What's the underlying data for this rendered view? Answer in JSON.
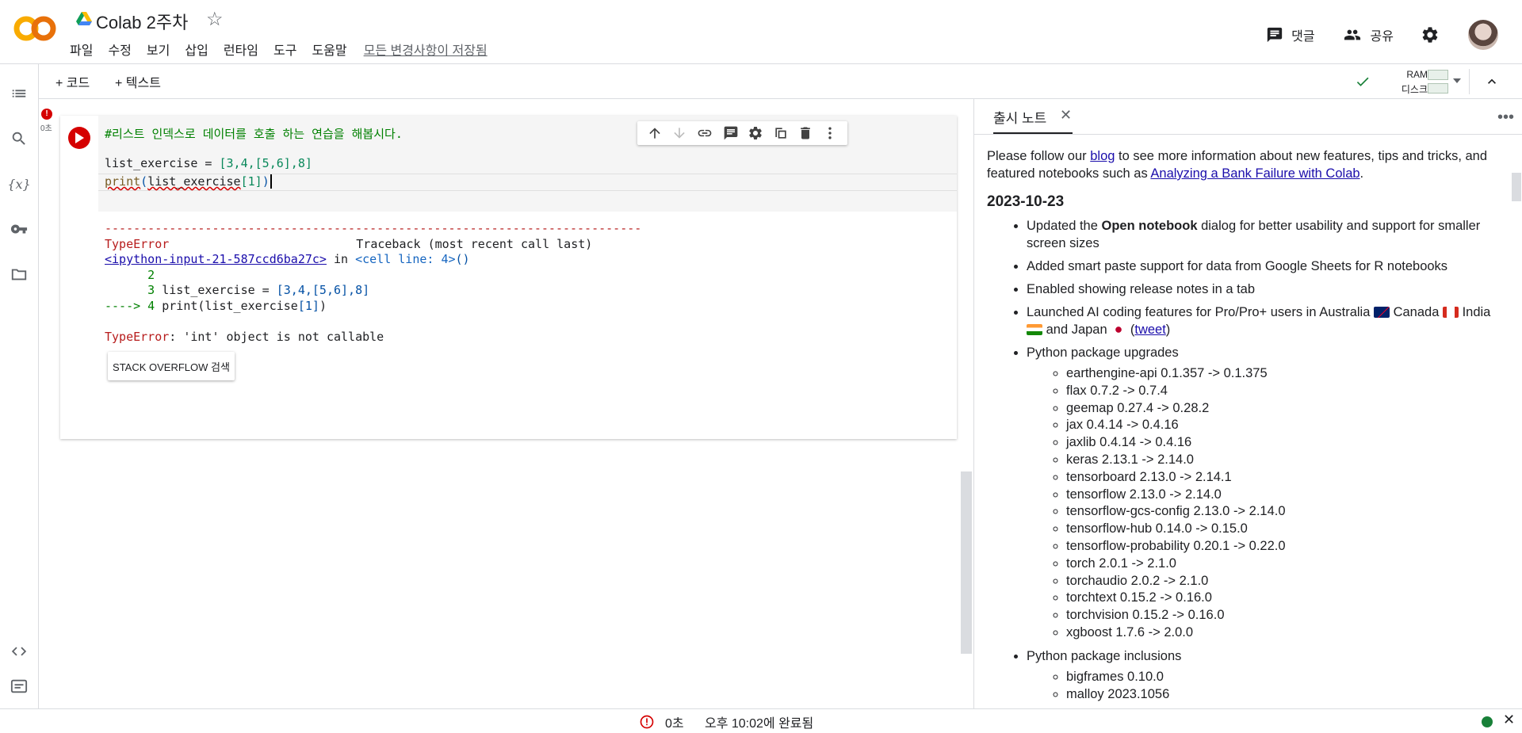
{
  "header": {
    "title": "Colab 2주차",
    "menu": [
      "파일",
      "수정",
      "보기",
      "삽입",
      "런타임",
      "도구",
      "도움말"
    ],
    "saved_status": "모든 변경사항이 저장됨",
    "comment_label": "댓글",
    "share_label": "공유"
  },
  "toolbar": {
    "add_code": "+ 코드",
    "add_text": "+ 텍스트",
    "ram_label": "RAM",
    "disk_label": "디스크"
  },
  "cell": {
    "exec_time": "0초",
    "error_badge": "!",
    "code": {
      "comment": "#리스트 인덱스로 데이터를 호출 하는 연습을 해봅시다.",
      "line2_var": "list_exercise = ",
      "line2_val": "[3,4,[5,6],8]",
      "line3_fn": "print",
      "line3_open": "(",
      "line3_arg": "list_exercise",
      "line3_idx": "[1]",
      "line3_close": ")"
    },
    "output": {
      "dashes": "---------------------------------------------------------------------------",
      "err_type": "TypeError",
      "traceback": "Traceback (most recent call last)",
      "input_link": "<ipython-input-21-587ccd6ba27c>",
      "in_word": " in ",
      "cell_line": "<cell line: 4>",
      "cell_line_parens": "()",
      "tb_l2_num": "      2",
      "tb_l3_num": "      3 ",
      "tb_l3_code": "list_exercise = ",
      "tb_l3_val": "[3,4,[5,6],8]",
      "tb_l4_arrow": "----> 4 ",
      "tb_l4_code": "print(list_exercise",
      "tb_l4_idx": "[1]",
      "tb_l4_close": ")",
      "final_type": "TypeError",
      "final_msg": ": 'int' object is not callable",
      "so_button": "STACK OVERFLOW 검색"
    }
  },
  "panel": {
    "tab_label": "출시 노트",
    "intro_1": "Please follow our ",
    "intro_link1": "blog",
    "intro_2": " to see more information about new features, tips and tricks, and featured notebooks such as ",
    "intro_link2": "Analyzing a Bank Failure with Colab",
    "intro_3": ".",
    "date": "2023-10-23",
    "item1_a": "Updated the ",
    "item1_b": "Open notebook",
    "item1_c": " dialog for better usability and support for smaller screen sizes",
    "item2": "Added smart paste support for data from Google Sheets for R notebooks",
    "item3": "Enabled showing release notes in a tab",
    "item4_a": "Launched AI coding features for Pro/Pro+ users in Australia",
    "item4_b": "Canada",
    "item4_c": "India",
    "item4_d": "and Japan",
    "item4_link": "tweet",
    "item5": "Python package upgrades",
    "upgrades": [
      "earthengine-api 0.1.357 -> 0.1.375",
      "flax 0.7.2 -> 0.7.4",
      "geemap 0.27.4 -> 0.28.2",
      "jax 0.4.14 -> 0.4.16",
      "jaxlib 0.4.14 -> 0.4.16",
      "keras 2.13.1 -> 2.14.0",
      "tensorboard 2.13.0 -> 2.14.1",
      "tensorflow 2.13.0 -> 2.14.0",
      "tensorflow-gcs-config 2.13.0 -> 2.14.0",
      "tensorflow-hub 0.14.0 -> 0.15.0",
      "tensorflow-probability 0.20.1 -> 0.22.0",
      "torch 2.0.1 -> 2.1.0",
      "torchaudio 2.0.2 -> 2.1.0",
      "torchtext 0.15.2 -> 0.16.0",
      "torchvision 0.15.2 -> 0.16.0",
      "xgboost 1.7.6 -> 2.0.0"
    ],
    "item6": "Python package inclusions",
    "inclusions": [
      "bigframes 0.10.0",
      "malloy 2023.1056"
    ]
  },
  "statusbar": {
    "time": "0초",
    "completed": "오후 10:02에 완료됨"
  },
  "colors": {
    "accent_orange": "#f9ab00",
    "run_red": "#d50000",
    "link_blue": "#1a0dab",
    "code_green": "#008000"
  }
}
